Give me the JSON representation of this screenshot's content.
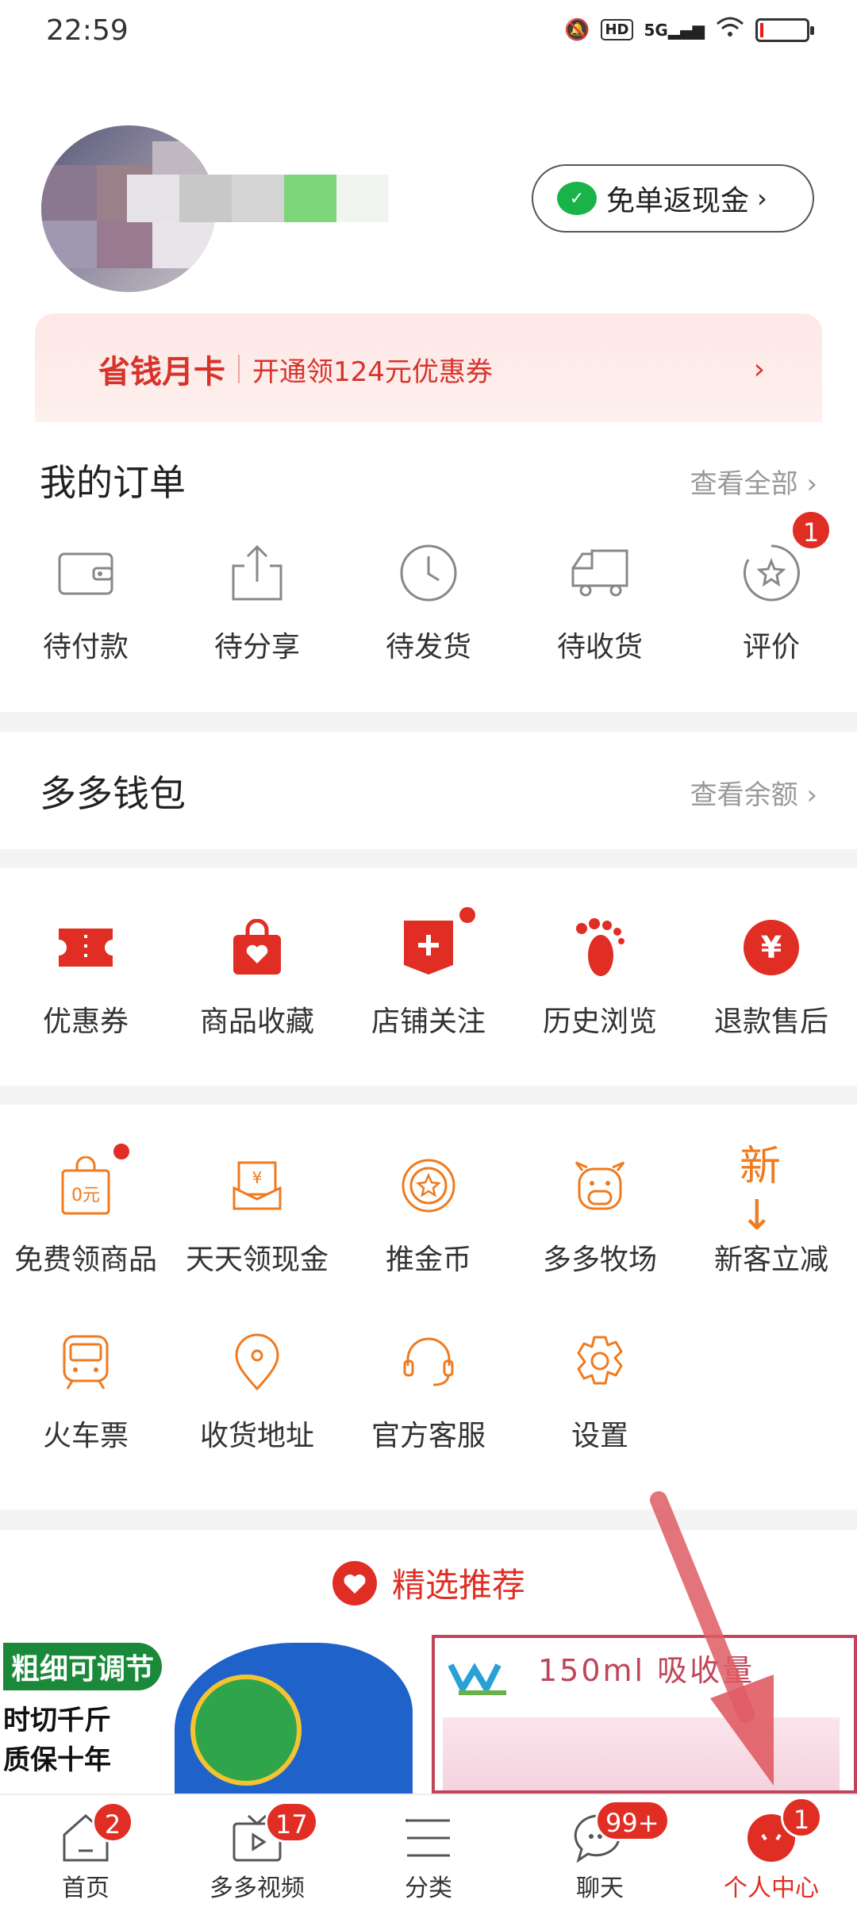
{
  "status_bar": {
    "time": "22:59",
    "hd": "HD",
    "network": "5G"
  },
  "header": {
    "cash_button": "免单返现金",
    "card_title": "省钱月卡",
    "card_subtitle": "开通领124元优惠券"
  },
  "orders": {
    "title": "我的订单",
    "view_all": "查看全部",
    "items": [
      {
        "label": "待付款",
        "icon": "wallet-icon"
      },
      {
        "label": "待分享",
        "icon": "share-icon"
      },
      {
        "label": "待发货",
        "icon": "clock-icon"
      },
      {
        "label": "待收货",
        "icon": "truck-icon"
      },
      {
        "label": "评价",
        "icon": "review-icon",
        "badge": "1"
      }
    ]
  },
  "wallet": {
    "title": "多多钱包",
    "link": "查看余额"
  },
  "services": {
    "items": [
      {
        "label": "优惠券",
        "icon": "coupon-icon"
      },
      {
        "label": "商品收藏",
        "icon": "bag-heart-icon"
      },
      {
        "label": "店铺关注",
        "icon": "store-follow-icon"
      },
      {
        "label": "历史浏览",
        "icon": "footprint-icon"
      },
      {
        "label": "退款售后",
        "icon": "refund-icon"
      }
    ]
  },
  "tools": {
    "row1": [
      {
        "label": "免费领商品",
        "icon": "free-bag-icon",
        "glyph": "0元"
      },
      {
        "label": "天天领现金",
        "icon": "cash-envelope-icon",
        "glyph": "¥"
      },
      {
        "label": "推金币",
        "icon": "coin-icon"
      },
      {
        "label": "多多牧场",
        "icon": "cow-icon"
      },
      {
        "label": "新客立减",
        "icon": "new-user-icon",
        "glyph": "新↓"
      }
    ],
    "row2": [
      {
        "label": "火车票",
        "icon": "train-icon"
      },
      {
        "label": "收货地址",
        "icon": "location-icon"
      },
      {
        "label": "官方客服",
        "icon": "headset-icon"
      },
      {
        "label": "设置",
        "icon": "settings-icon"
      }
    ]
  },
  "recommend": {
    "title": "精选推荐",
    "product1": {
      "tag": "粗细可调节",
      "line1": "时切千斤",
      "line2": "质保十年"
    },
    "product2": {
      "text": "150ml 吸收量"
    }
  },
  "tabbar": [
    {
      "label": "首页",
      "badge": "2"
    },
    {
      "label": "多多视频",
      "badge": "17"
    },
    {
      "label": "分类",
      "badge": ""
    },
    {
      "label": "聊天",
      "badge": "99+"
    },
    {
      "label": "个人中心",
      "badge": "1"
    }
  ],
  "colors": {
    "accent": "#e02e24",
    "orange": "#f07a1e",
    "bg": "#f4f4f4"
  }
}
